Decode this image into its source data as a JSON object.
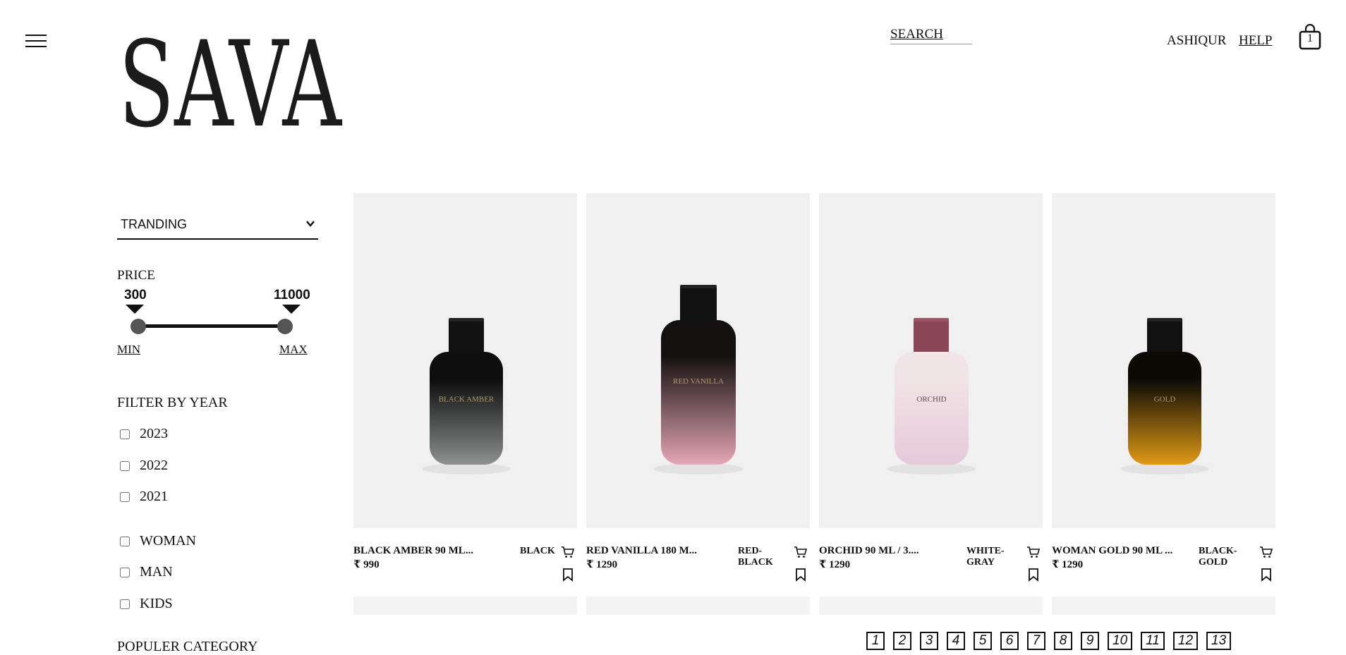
{
  "header": {
    "brand": "SAVA",
    "search_placeholder": "SEARCH",
    "user": "ASHIQUR",
    "help": "HELP",
    "cart_count": "1"
  },
  "sidebar": {
    "sort_selected": "TRANDING",
    "price": {
      "title": "PRICE",
      "min_value": "300",
      "max_value": "11000",
      "min_label": "MIN",
      "max_label": "MAX"
    },
    "filter_year_title": "FILTER BY YEAR",
    "years": [
      "2023",
      "2022",
      "2021"
    ],
    "audience": [
      "WOMAN",
      "MAN",
      "KIDS"
    ],
    "category_title": "POPULER CATEGORY"
  },
  "products": [
    {
      "name": "BLACK AMBER 90 ML...",
      "price": "₹ 990",
      "color_line1": "BLACK",
      "color_line2": "",
      "bottle_label": "BLACK AMBER",
      "colors": {
        "cap": "#111111",
        "top": "#0e0e0e",
        "bottom": "#8e9191",
        "cap_top": "#222222"
      }
    },
    {
      "name": "RED VANILLA 180 M...",
      "price": "₹ 1290",
      "color_line1": "RED-",
      "color_line2": "BLACK",
      "bottle_label": "RED VANILLA",
      "colors": {
        "cap": "#111111",
        "top": "#141010",
        "bottom": "#e6a7b5",
        "cap_top": "#222222"
      }
    },
    {
      "name": "ORCHID 90 ML / 3....",
      "price": "₹ 1290",
      "color_line1": "WHITE-",
      "color_line2": "GRAY",
      "bottle_label": "ORCHID",
      "colors": {
        "cap": "#8a4657",
        "top": "#f1e4e6",
        "bottom": "#e6c8d9",
        "cap_top": "#9c5567"
      }
    },
    {
      "name": "WOMAN GOLD 90 ML ...",
      "price": "₹ 1290",
      "color_line1": "BLACK-",
      "color_line2": "GOLD",
      "bottle_label": "GOLD",
      "colors": {
        "cap": "#111111",
        "top": "#0d0a06",
        "bottom": "#e09a16",
        "cap_top": "#222222"
      }
    }
  ],
  "pagination": [
    "1",
    "2",
    "3",
    "4",
    "5",
    "6",
    "7",
    "8",
    "9",
    "10",
    "11",
    "12",
    "13"
  ]
}
